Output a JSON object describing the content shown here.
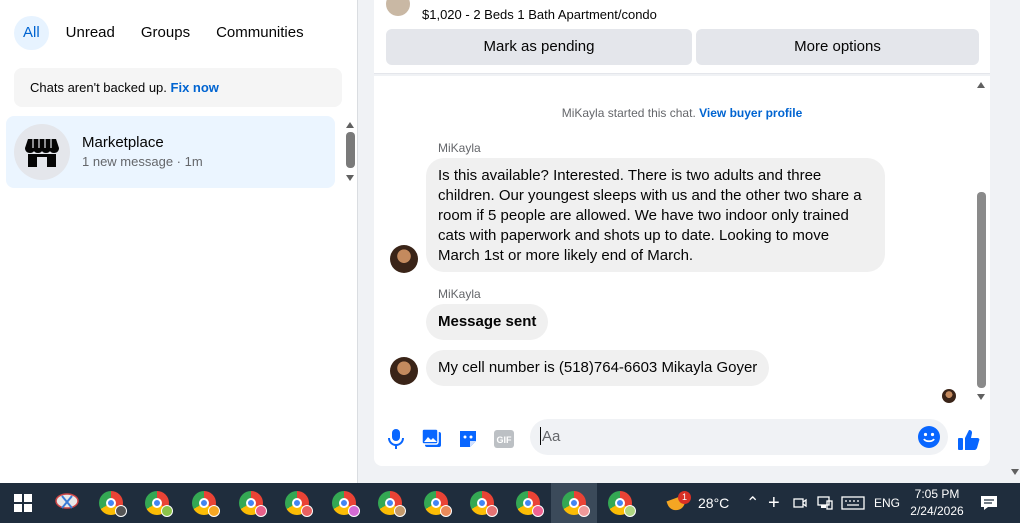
{
  "filters": [
    "All",
    "Unread",
    "Groups",
    "Communities"
  ],
  "backup_notice": {
    "text": "Chats aren't backed up. ",
    "link": "Fix now"
  },
  "chat_list": [
    {
      "name": "Marketplace",
      "preview": "1 new message",
      "time": "1m"
    }
  ],
  "listing": {
    "text": "$1,020 - 2 Beds 1 Bath Apartment/condo"
  },
  "actions": {
    "pending": "Mark as pending",
    "more": "More options"
  },
  "conversation": {
    "started_text": "MiKayla started this chat. ",
    "started_link": "View buyer profile",
    "messages": [
      {
        "sender": "MiKayla",
        "text": "Is this available? Interested. There is two adults and three children. Our youngest sleeps with us and the other two share a room if 5 people are allowed. We have two indoor only trained cats with paperwork and shots up to date. Looking to move March 1st or more likely end of March."
      },
      {
        "sender": "MiKayla",
        "text": "Message sent"
      },
      {
        "sender": "",
        "text": "My cell number is (518)764-6603 Mikayla Goyer"
      }
    ]
  },
  "composer": {
    "placeholder": "Aa"
  },
  "taskbar": {
    "weather_temp": "28°C",
    "weather_badge": "1",
    "lang": "ENG",
    "time": "7:05 PM",
    "date": "2/24/2026"
  },
  "colors": {
    "accent": "#0064d1",
    "bubble": "#f0f0f0",
    "taskbar": "#1f2d3d"
  }
}
